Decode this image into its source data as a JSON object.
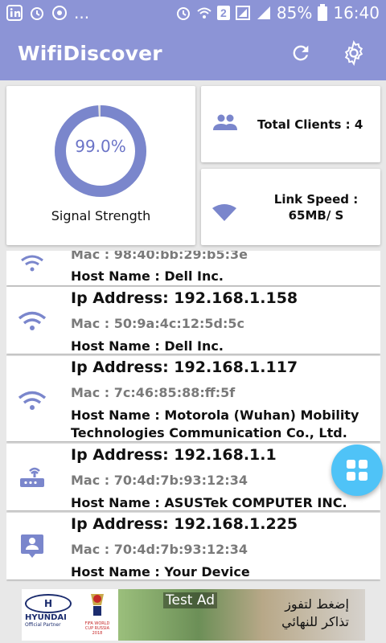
{
  "status_bar": {
    "left_ellipsis": "...",
    "battery": "85%",
    "time": "16:40",
    "sim": "2"
  },
  "app_bar": {
    "title": "WifiDiscover"
  },
  "signal": {
    "percent_text": "99.0%",
    "level": 0.99,
    "label": "Signal Strength"
  },
  "clients": {
    "label": "Total Clients : 4"
  },
  "speed": {
    "label": "Link Speed : 65MB/ S"
  },
  "devices": [
    {
      "icon": "wifi-icon",
      "ip": "",
      "mac": "Mac : 98:40:bb:29:b5:3e",
      "host": "Host Name  : Dell Inc.",
      "host_line2": ""
    },
    {
      "icon": "wifi-icon",
      "ip": "Ip Address: 192.168.1.158",
      "mac": "Mac : 50:9a:4c:12:5d:5c",
      "host": "Host Name  : Dell Inc.",
      "host_line2": ""
    },
    {
      "icon": "wifi-icon",
      "ip": "Ip Address: 192.168.1.117",
      "mac": "Mac : 7c:46:85:88:ff:5f",
      "host": "Host Name  : Motorola (Wuhan) Mobility",
      "host_line2": "Technologies Communication Co., Ltd."
    },
    {
      "icon": "router-icon",
      "ip": "Ip Address: 192.168.1.1",
      "mac": "Mac : 70:4d:7b:93:12:34",
      "host": "Host Name  : ASUSTek COMPUTER INC.",
      "host_line2": ""
    },
    {
      "icon": "person-icon",
      "ip": "Ip Address: 192.168.1.225",
      "mac": "Mac : 70:4d:7b:93:12:34",
      "host": "Host Name  : Your Device",
      "host_line2": ""
    }
  ],
  "ad": {
    "test_label": "Test Ad",
    "brand": "HYUNDAI",
    "brand_sub": "Official Partner",
    "event": "FIFA WORLD CUP RUSSIA 2018",
    "arabic_line1": "إضغط لتفوز",
    "arabic_line2": "تذاكر للنهائي"
  },
  "colors": {
    "primary": "#8c94d6",
    "accent_text": "#6b74c7",
    "fab": "#4fc3f7",
    "icon": "#7a86cc"
  }
}
